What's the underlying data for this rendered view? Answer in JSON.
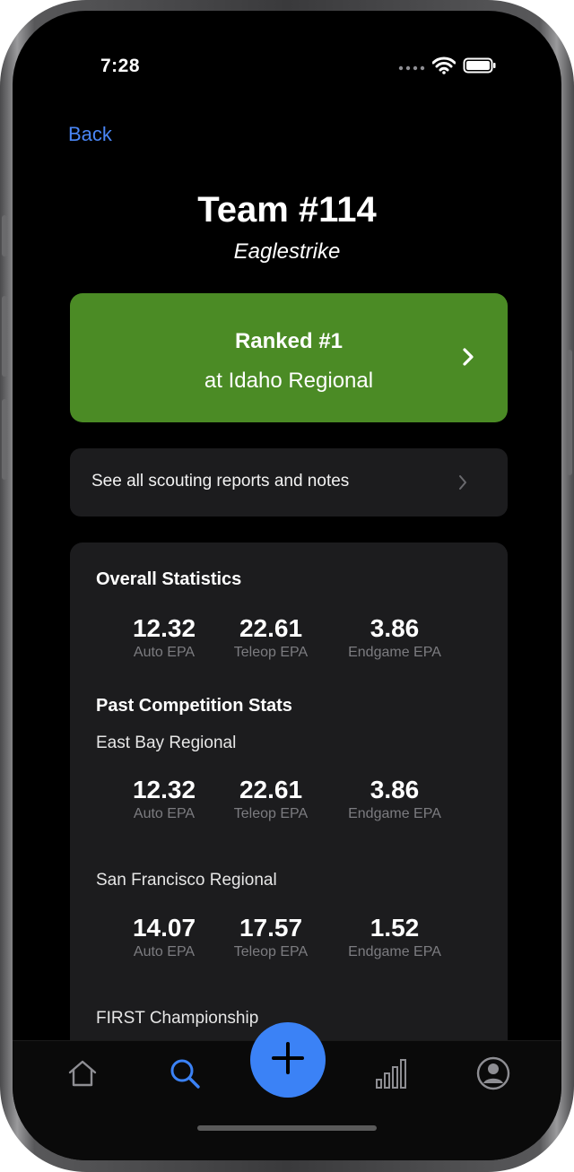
{
  "status": {
    "time": "7:28"
  },
  "nav": {
    "back_label": "Back"
  },
  "team": {
    "title": "Team #114",
    "name": "Eaglestrike"
  },
  "rank_card": {
    "line1": "Ranked #1",
    "line2": "at Idaho Regional",
    "color": "#4b8b25"
  },
  "reports_link": {
    "label": "See all scouting reports and notes"
  },
  "overall": {
    "heading": "Overall Statistics",
    "stats": [
      {
        "value": "12.32",
        "label": "Auto EPA"
      },
      {
        "value": "22.61",
        "label": "Teleop EPA"
      },
      {
        "value": "3.86",
        "label": "Endgame EPA"
      }
    ]
  },
  "past": {
    "heading": "Past Competition Stats",
    "competitions": [
      {
        "name": "East Bay Regional",
        "stats": [
          {
            "value": "12.32",
            "label": "Auto EPA"
          },
          {
            "value": "22.61",
            "label": "Teleop EPA"
          },
          {
            "value": "3.86",
            "label": "Endgame EPA"
          }
        ]
      },
      {
        "name": "San Francisco Regional",
        "stats": [
          {
            "value": "14.07",
            "label": "Auto EPA"
          },
          {
            "value": "17.57",
            "label": "Teleop EPA"
          },
          {
            "value": "1.52",
            "label": "Endgame EPA"
          }
        ]
      },
      {
        "name": "FIRST Championship"
      }
    ]
  },
  "tabs": [
    {
      "icon": "home-icon",
      "active": false
    },
    {
      "icon": "search-icon",
      "active": true
    },
    {
      "icon": "add-icon",
      "active": false
    },
    {
      "icon": "chart-bars-icon",
      "active": false
    },
    {
      "icon": "profile-icon",
      "active": false
    }
  ],
  "colors": {
    "accent": "#3b82f6",
    "link": "#4a86f5",
    "card": "#1c1c1e",
    "background": "#000000"
  }
}
